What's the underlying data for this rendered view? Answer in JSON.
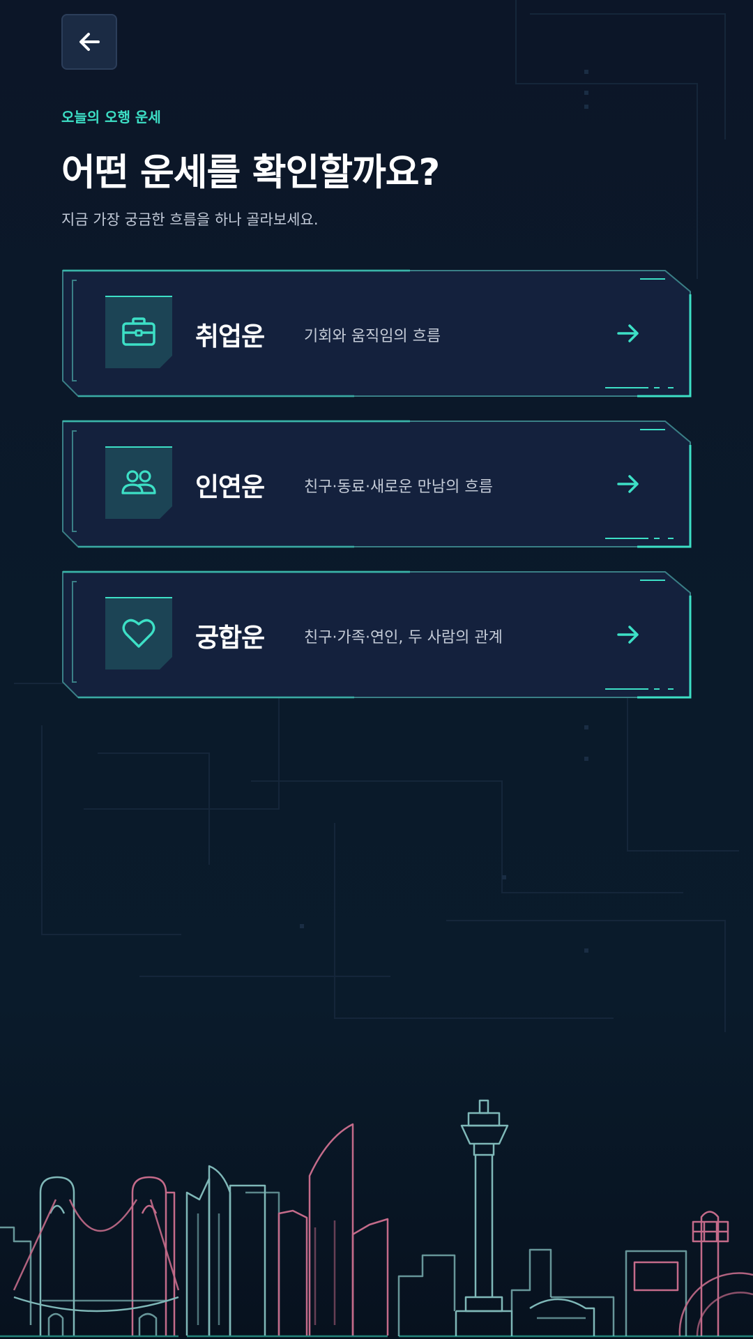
{
  "header": {
    "back_icon": "arrow-left-icon",
    "eyebrow": "오늘의 오행 운세",
    "title": "어떤 운세를 확인할까요?",
    "subtitle": "지금 가장 궁금한 흐름을 하나 골라보세요."
  },
  "options": [
    {
      "icon": "briefcase-icon",
      "title": "취업운",
      "desc": "기회와 움직임의 흐름"
    },
    {
      "icon": "users-icon",
      "title": "인연운",
      "desc": "친구·동료·새로운 만남의 흐름"
    },
    {
      "icon": "heart-icon",
      "title": "궁합운",
      "desc": "친구·가족·연인, 두 사람의 관계"
    }
  ],
  "colors": {
    "accent": "#3de0c6",
    "background": "#0b1424",
    "card": "#14213d",
    "skyline_teal": "#7fb8b8",
    "skyline_pink": "#c46b8a"
  }
}
